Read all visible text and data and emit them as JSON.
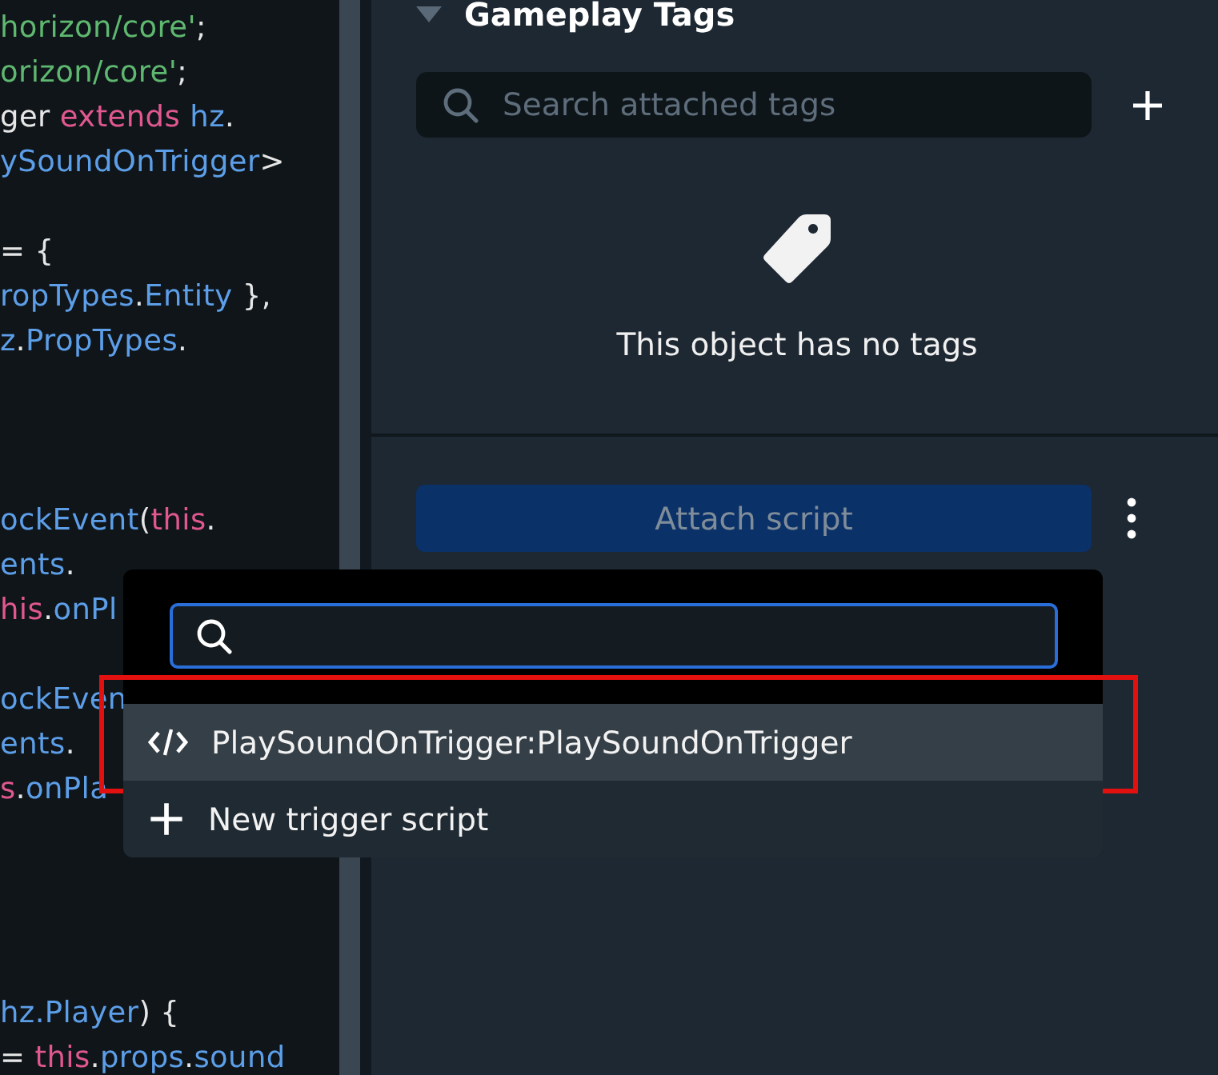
{
  "code_lines": [
    {
      "kind": "code",
      "tokens": [
        {
          "kind": "string",
          "text": "horizon/core'"
        },
        {
          "kind": "plain",
          "text": ";"
        }
      ]
    },
    {
      "kind": "code",
      "tokens": [
        {
          "kind": "string",
          "text": "orizon/core'"
        },
        {
          "kind": "plain",
          "text": ";"
        }
      ]
    },
    {
      "kind": "code",
      "tokens": [
        {
          "kind": "plain",
          "text": "ger"
        },
        {
          "kind": "keyword",
          "text": " extends"
        },
        {
          "kind": "ident",
          "text": " hz"
        },
        {
          "kind": "plain",
          "text": "."
        }
      ]
    },
    {
      "kind": "code",
      "tokens": [
        {
          "kind": "ident",
          "text": "ySoundOnTrigger"
        },
        {
          "kind": "plain",
          "text": ">"
        }
      ]
    },
    {
      "kind": "blank"
    },
    {
      "kind": "code",
      "tokens": [
        {
          "kind": "plain",
          "text": "= {"
        }
      ]
    },
    {
      "kind": "code",
      "tokens": [
        {
          "kind": "ident",
          "text": "ropTypes"
        },
        {
          "kind": "plain",
          "text": "."
        },
        {
          "kind": "ident",
          "text": "Entity"
        },
        {
          "kind": "plain",
          "text": " },"
        }
      ]
    },
    {
      "kind": "code",
      "tokens": [
        {
          "kind": "ident",
          "text": "z"
        },
        {
          "kind": "plain",
          "text": "."
        },
        {
          "kind": "ident",
          "text": "PropTypes"
        },
        {
          "kind": "plain",
          "text": "."
        }
      ]
    },
    {
      "kind": "blank"
    },
    {
      "kind": "blank"
    },
    {
      "kind": "blank"
    },
    {
      "kind": "code",
      "tokens": [
        {
          "kind": "ident",
          "text": "ockEvent"
        },
        {
          "kind": "plain",
          "text": "("
        },
        {
          "kind": "keyword",
          "text": "this"
        },
        {
          "kind": "plain",
          "text": "."
        }
      ]
    },
    {
      "kind": "code",
      "tokens": [
        {
          "kind": "ident",
          "text": "ents"
        },
        {
          "kind": "plain",
          "text": "."
        }
      ]
    },
    {
      "kind": "code",
      "tokens": [
        {
          "kind": "keyword",
          "text": "his"
        },
        {
          "kind": "plain",
          "text": "."
        },
        {
          "kind": "ident",
          "text": "onPl"
        }
      ]
    },
    {
      "kind": "blank"
    },
    {
      "kind": "code",
      "tokens": [
        {
          "kind": "ident",
          "text": "ockEven"
        }
      ]
    },
    {
      "kind": "code",
      "tokens": [
        {
          "kind": "ident",
          "text": "ents"
        },
        {
          "kind": "plain",
          "text": "."
        }
      ]
    },
    {
      "kind": "code",
      "tokens": [
        {
          "kind": "keyword",
          "text": "s"
        },
        {
          "kind": "plain",
          "text": "."
        },
        {
          "kind": "ident",
          "text": "onPla"
        }
      ]
    },
    {
      "kind": "blank"
    },
    {
      "kind": "blank"
    },
    {
      "kind": "blank"
    },
    {
      "kind": "blank"
    },
    {
      "kind": "code",
      "tokens": [
        {
          "kind": "ident",
          "text": "hz.Player"
        },
        {
          "kind": "plain",
          "text": ") {"
        }
      ]
    },
    {
      "kind": "code",
      "tokens": [
        {
          "kind": "plain",
          "text": "= "
        },
        {
          "kind": "keyword",
          "text": "this"
        },
        {
          "kind": "plain",
          "text": "."
        },
        {
          "kind": "ident",
          "text": "props"
        },
        {
          "kind": "plain",
          "text": "."
        },
        {
          "kind": "ident",
          "text": "sound"
        }
      ]
    }
  ],
  "gameplay_tags": {
    "title": "Gameplay Tags",
    "expanded": true,
    "search": {
      "placeholder": "Search attached tags"
    },
    "empty_message": "This object has no tags"
  },
  "attach_button": {
    "label": "Attach script",
    "disabled": true
  },
  "script_menu": {
    "search": {
      "focused": true
    },
    "items": [
      {
        "kind": "script",
        "label": "PlaySoundOnTrigger:PlaySoundOnTrigger",
        "selected": true,
        "outlined": true
      },
      {
        "kind": "new",
        "label": "New trigger script",
        "selected": false,
        "outlined": false
      }
    ]
  }
}
